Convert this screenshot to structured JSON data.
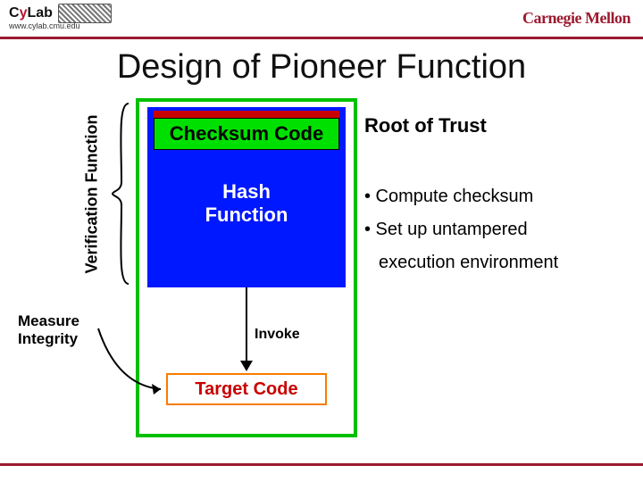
{
  "header": {
    "cylab_text_1": "C",
    "cylab_text_2": "y",
    "cylab_text_3": "Lab",
    "cylab_url": "www.cylab.cmu.edu",
    "cmu": "Carnegie Mellon"
  },
  "title": "Design of Pioneer Function",
  "diagram": {
    "verification_label": "Verification Function",
    "checksum_label": "Checksum Code",
    "hash_label_l1": "Hash",
    "hash_label_l2": "Function",
    "invoke_label": "Invoke",
    "target_label": "Target Code",
    "measure_l1": "Measure",
    "measure_l2": "Integrity"
  },
  "right": {
    "root": "Root of Trust",
    "b1": "• Compute checksum",
    "b2": "• Set up untampered",
    "b2b": "execution environment"
  }
}
